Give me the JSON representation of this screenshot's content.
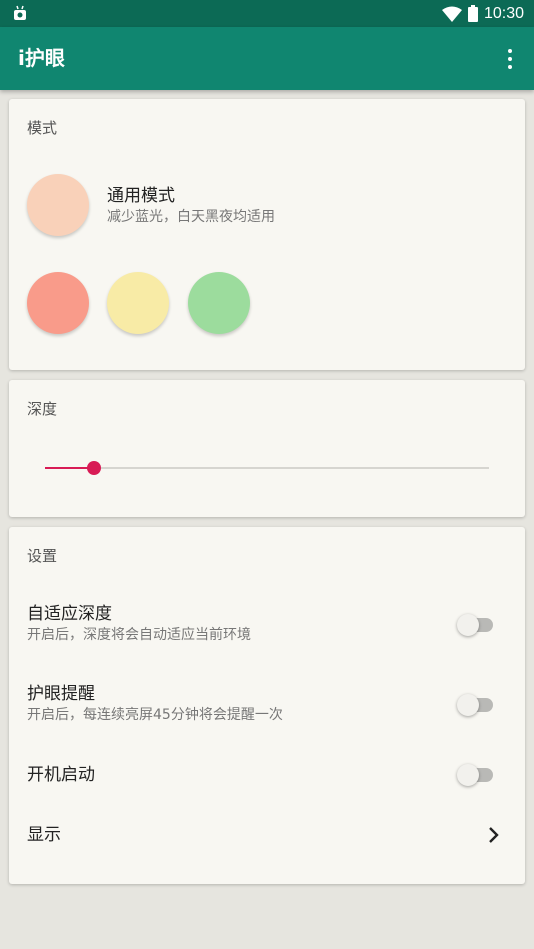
{
  "status_bar": {
    "time": "10:30",
    "icons": [
      "android-notification-icon",
      "wifi-icon",
      "battery-icon"
    ]
  },
  "app_bar": {
    "title": "i护眼",
    "menu_icon": "more-vert-icon"
  },
  "mode_card": {
    "title": "模式",
    "current_mode": {
      "name": "通用模式",
      "description": "减少蓝光，白天黑夜均适用",
      "color": "#f9d1b9"
    },
    "options": [
      {
        "color": "#f99b8a"
      },
      {
        "color": "#f8eba6"
      },
      {
        "color": "#9cdc9d"
      }
    ]
  },
  "depth_card": {
    "title": "深度",
    "value": 0.11,
    "accent_color": "#d81b55"
  },
  "settings_card": {
    "title": "设置",
    "items": [
      {
        "label": "自适应深度",
        "description": "开启后，深度将会自动适应当前环境",
        "enabled": false
      },
      {
        "label": "护眼提醒",
        "description": "开启后，每连续亮屏45分钟将会提醒一次",
        "enabled": false
      },
      {
        "label": "开机启动",
        "enabled": false
      },
      {
        "label": "显示",
        "icon": "chevron-right-icon"
      }
    ]
  }
}
